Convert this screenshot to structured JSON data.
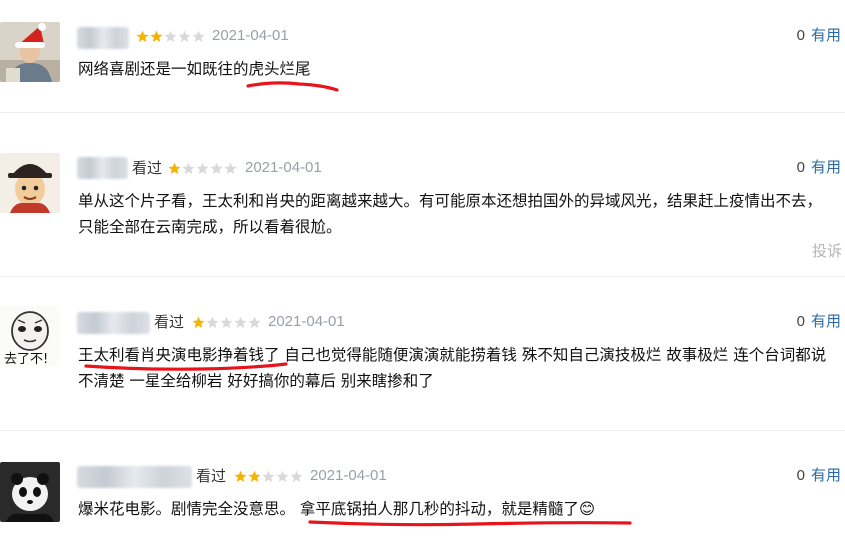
{
  "useful_label": "有用",
  "report_label": "投诉",
  "star_color_on": "#f5b400",
  "star_color_off": "#d9d9d9",
  "annotation_color": "#e8141c",
  "comments": [
    {
      "watched": "",
      "rating": 2,
      "date": "2021-04-01",
      "useful_count": "0",
      "text": "网络喜剧还是一如既往的虎头烂尾"
    },
    {
      "watched": "看过",
      "rating": 1,
      "date": "2021-04-01",
      "useful_count": "0",
      "text": "单从这个片子看，王太利和肖央的距离越来越大。有可能原本还想拍国外的异域风光，结果赶上疫情出不去，只能全部在云南完成，所以看着很尬。"
    },
    {
      "watched": "看过",
      "rating": 1,
      "date": "2021-04-01",
      "useful_count": "0",
      "text": "王太利看肖央演电影挣着钱了 自己也觉得能随便演演就能捞着钱 殊不知自己演技极烂 故事极烂 连个台词都说不清楚 一星全给柳岩 好好搞你的幕后 别来瞎掺和了",
      "avatar_caption": "去了不!"
    },
    {
      "watched": "看过",
      "rating": 2,
      "date": "2021-04-01",
      "useful_count": "0",
      "text": "爆米花电影。剧情完全没意思。 拿平底锅拍人那几秒的抖动，就是精髓了😊"
    }
  ]
}
